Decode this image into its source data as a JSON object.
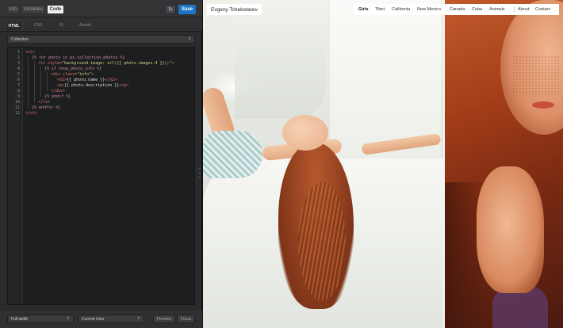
{
  "editor": {
    "top_tabs": [
      "Info",
      "Variables",
      "Code"
    ],
    "refresh_icon": "↻",
    "save_label": "Save",
    "sub_tabs": [
      "HTML",
      "CSS",
      "JS",
      "Assets"
    ],
    "collection_select": "Collection",
    "select_caret": "⇕",
    "line_numbers": [
      "1",
      "2",
      "3",
      "4",
      "5",
      "6",
      "7",
      "8",
      "9",
      "10",
      "11",
      "12"
    ],
    "code": {
      "l1_tag": "<ul>",
      "l2_tpl": "{% for photo in px.collection.photos %}",
      "l3_a": "<li style=",
      "l3_b": "\"background-image: url({{ photo.images.4 }});\"",
      "l3_c": ">",
      "l4_tpl": "{% if show_photo_info %}",
      "l5_a": "<div class=",
      "l5_b": "\"info\"",
      "l5_c": ">",
      "l6_a": "<h2>",
      "l6_b": "{{ photo.name }}",
      "l6_c": "</h2>",
      "l7_a": "<p>",
      "l7_b": "{{ photo.description }}",
      "l7_c": "</p>",
      "l8_tag": "</div>",
      "l9_tpl": "{% endif %}",
      "l10_tag": "</li>",
      "l11_tpl": "{% endfor %}",
      "l12_tag": "</ul>"
    },
    "bottom": {
      "width_select": "Full width",
      "user_select": "Current User",
      "preview_label": "Preview",
      "focus_label": "Focus"
    }
  },
  "preview": {
    "site_title": "Evgeny Tchebotarev",
    "nav_items": [
      "Girls",
      "Tibet",
      "California",
      "New Mexico",
      "Canada",
      "Cuba",
      "Animals",
      "About",
      "Contact"
    ],
    "active_nav": "Girls"
  },
  "colors": {
    "save_button": "#1e74c8",
    "editor_bg": "#2a2b2c",
    "code_bg": "#1d1e1f",
    "tag": "#e27a6f",
    "template": "#d08ca8",
    "string": "#cfd58a"
  }
}
